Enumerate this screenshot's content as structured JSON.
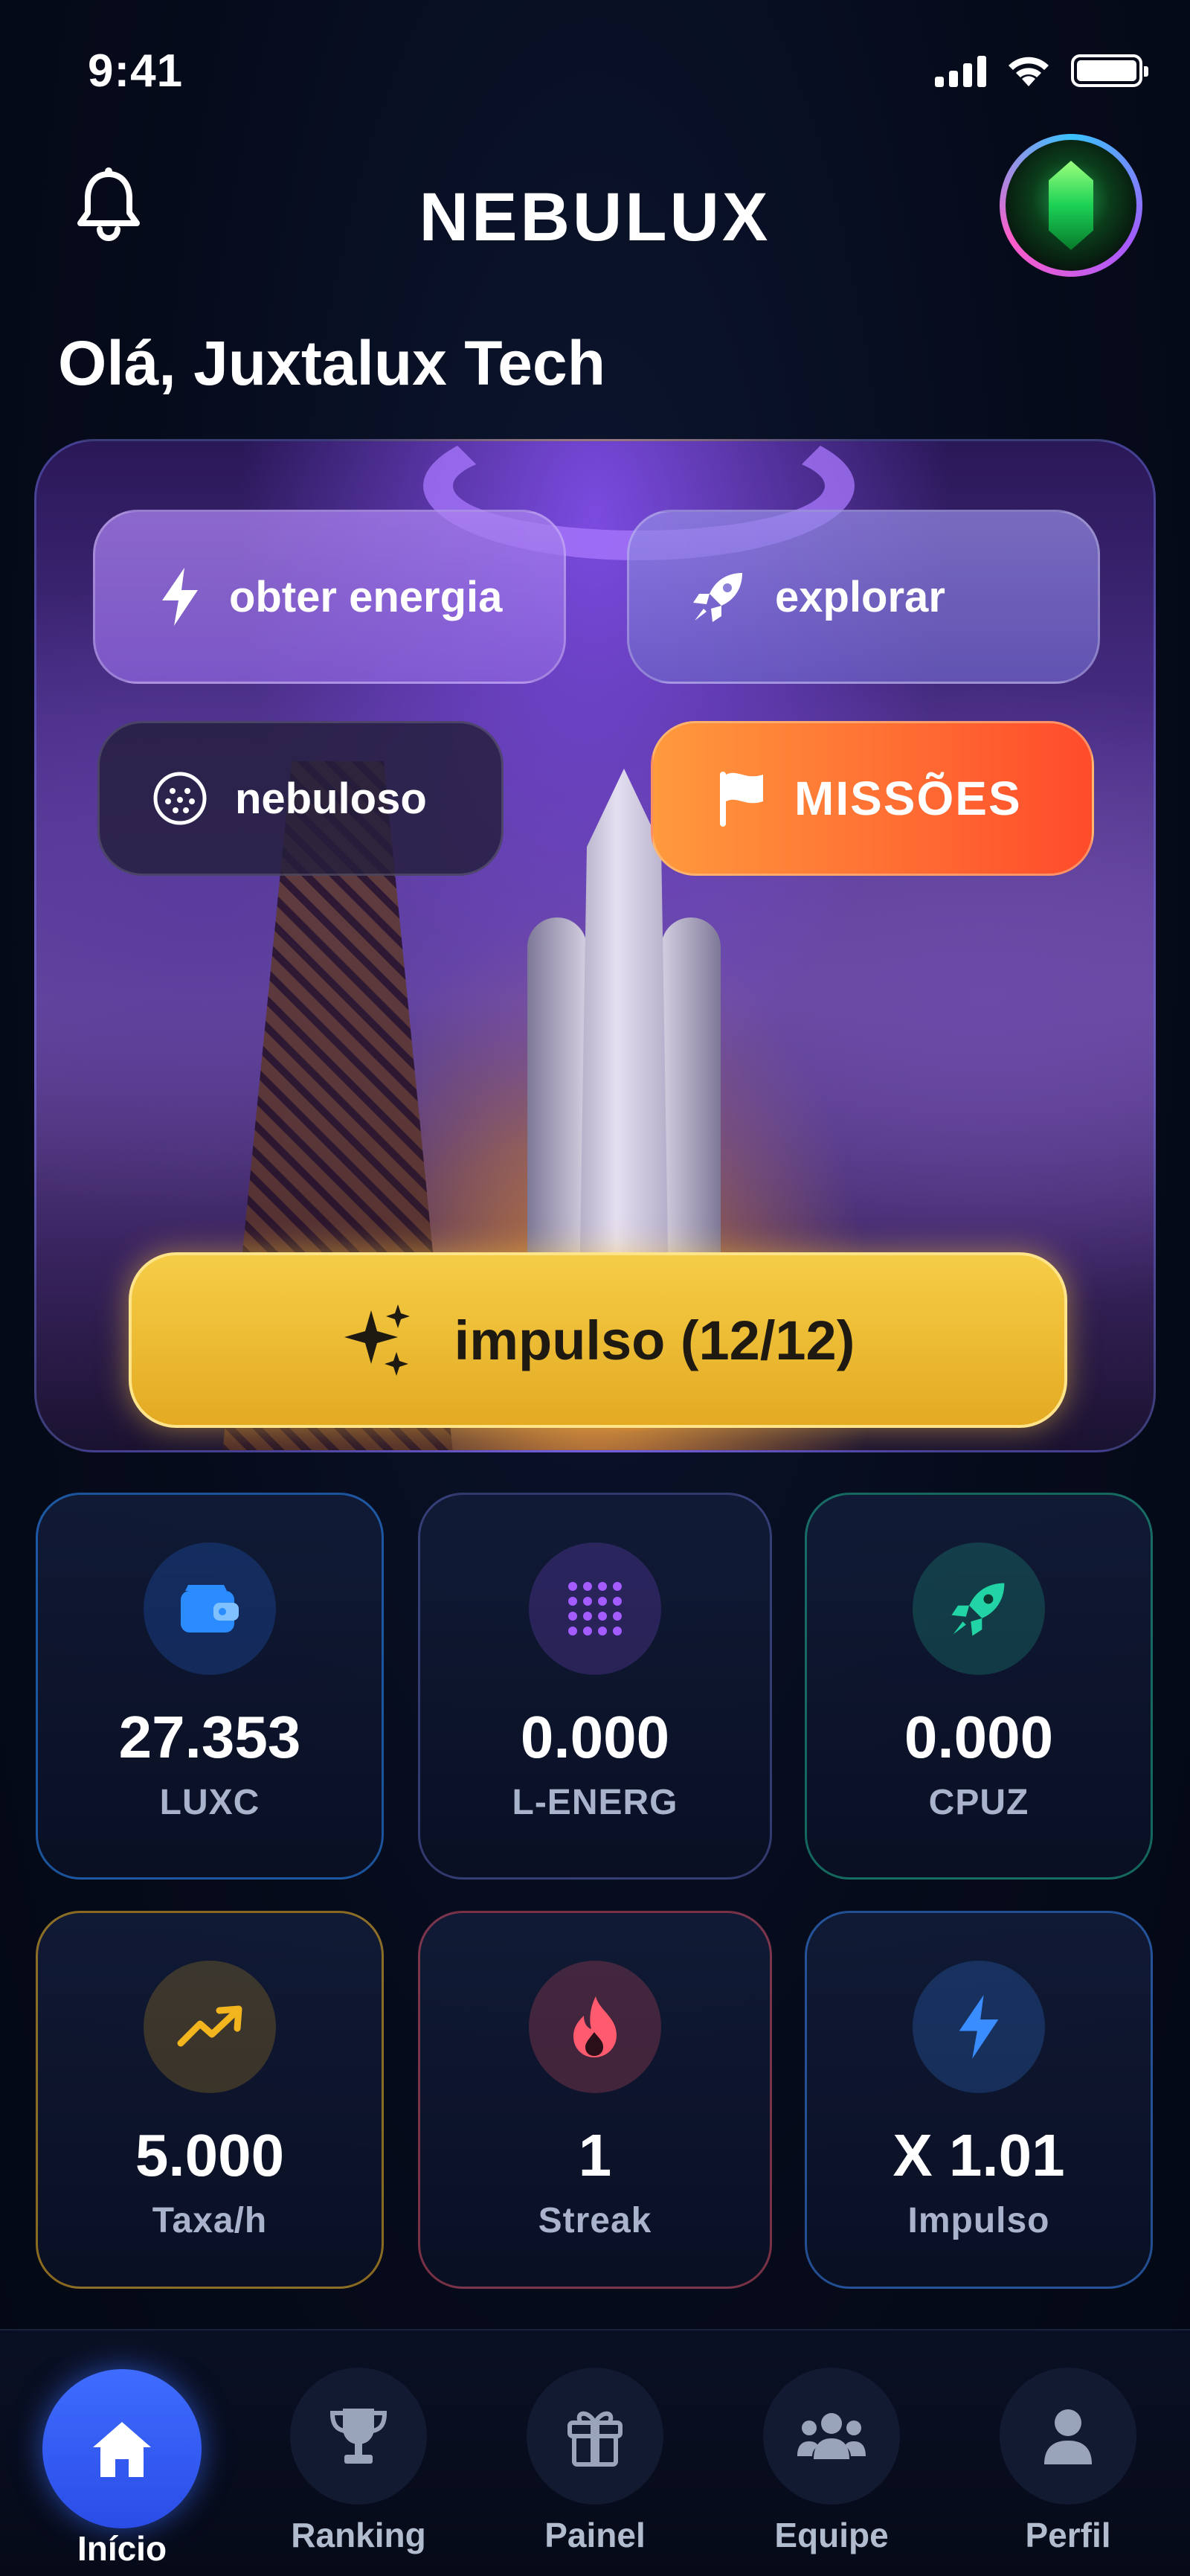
{
  "status_bar": {
    "time": "9:41"
  },
  "header": {
    "title": "NEBULUX"
  },
  "greeting": "Olá, Juxtalux Tech",
  "hero": {
    "actions": {
      "energy_label": "obter energia",
      "explore_label": "explorar",
      "nebula_label": "nebuloso",
      "missions_label": "MISSÕES"
    },
    "boost_label": "impulso (12/12)"
  },
  "stats": [
    {
      "value": "27.353",
      "label": "LUXC",
      "icon": "wallet-icon",
      "color": "#2a8cff"
    },
    {
      "value": "0.000",
      "label": "L-ENERG",
      "icon": "grid-dots-icon",
      "color": "#a45bff"
    },
    {
      "value": "0.000",
      "label": "CPUZ",
      "icon": "rocket-icon",
      "color": "#22d3a5"
    },
    {
      "value": "5.000",
      "label": "Taxa/h",
      "icon": "trend-up-icon",
      "color": "#f2b51e"
    },
    {
      "value": "1",
      "label": "Streak",
      "icon": "flame-icon",
      "color": "#ff5a6e"
    },
    {
      "value": "X 1.01",
      "label": "Impulso",
      "icon": "lightning-icon",
      "color": "#3a8dff"
    }
  ],
  "nav": {
    "items": [
      {
        "label": "Início",
        "icon": "home-icon",
        "active": true
      },
      {
        "label": "Ranking",
        "icon": "trophy-icon"
      },
      {
        "label": "Painel",
        "icon": "gift-icon"
      },
      {
        "label": "Equipe",
        "icon": "team-icon"
      },
      {
        "label": "Perfil",
        "icon": "user-icon"
      }
    ]
  },
  "colors": {
    "accent_blue": "#3f6cff",
    "boost_yellow": "#f6cd47",
    "missions_orange": "#ff6a30",
    "background": "#050a18"
  }
}
